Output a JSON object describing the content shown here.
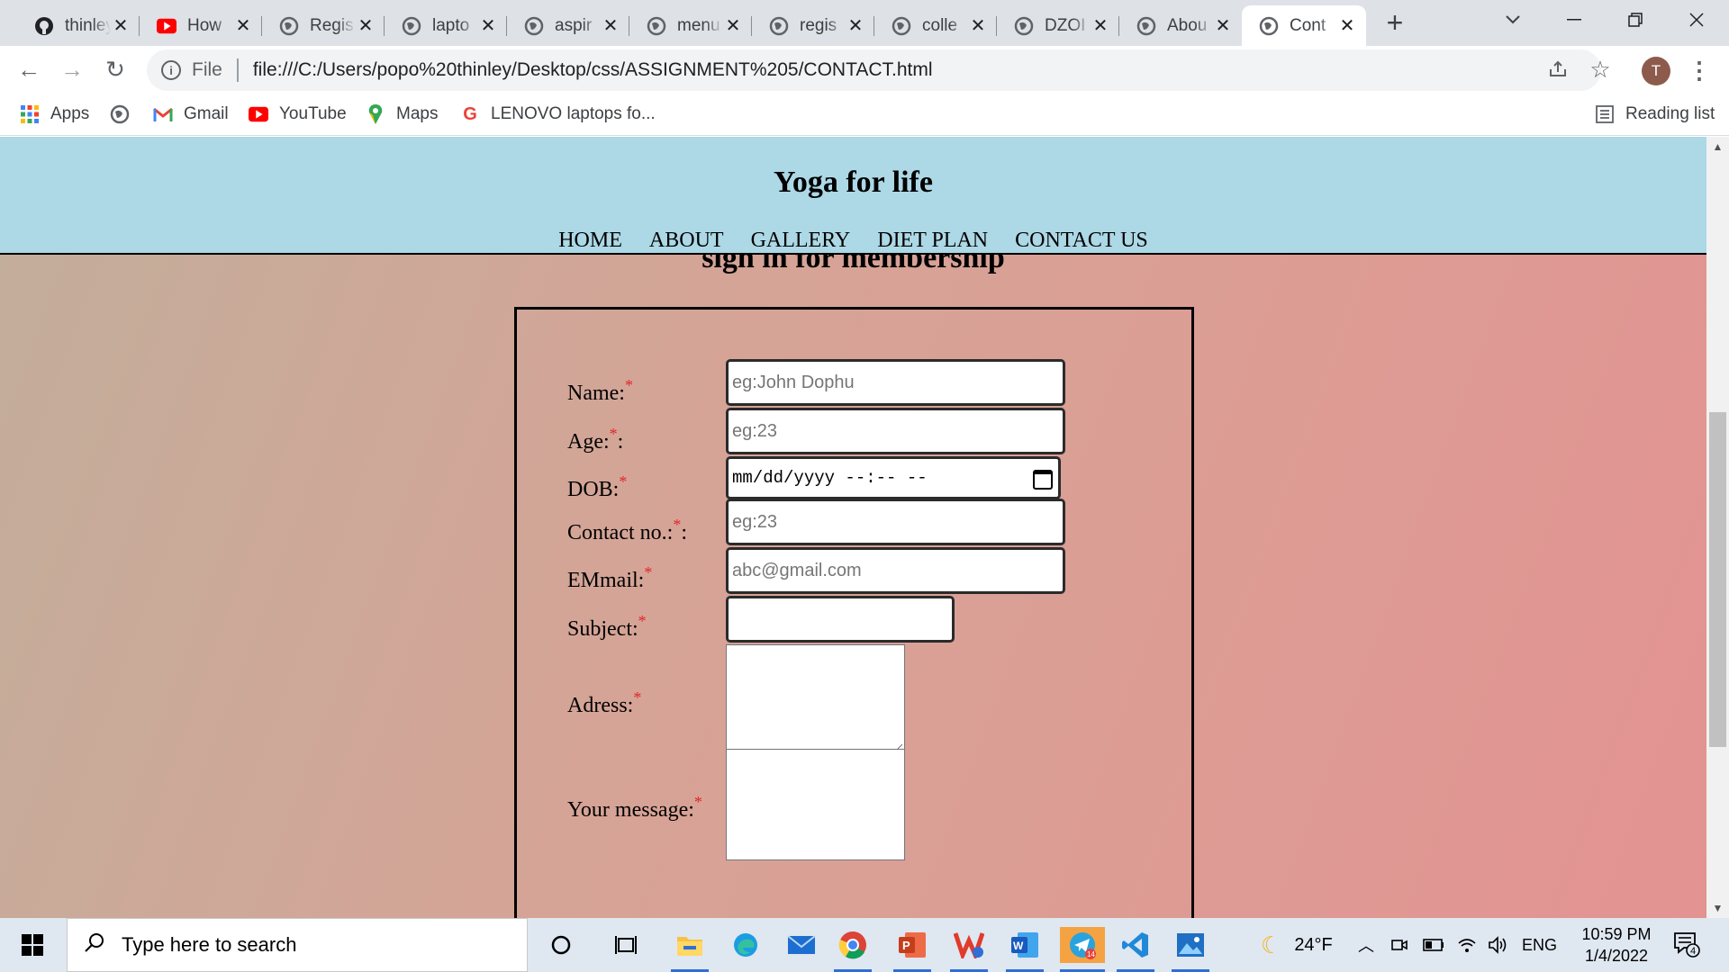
{
  "browser": {
    "tabs": [
      {
        "title": "thinley",
        "icon": "github-icon"
      },
      {
        "title": "How",
        "icon": "youtube-icon"
      },
      {
        "title": "Regis",
        "icon": "globe-icon"
      },
      {
        "title": "lapto",
        "icon": "globe-icon"
      },
      {
        "title": "aspir",
        "icon": "globe-icon"
      },
      {
        "title": "menu",
        "icon": "globe-icon"
      },
      {
        "title": "regis",
        "icon": "globe-icon"
      },
      {
        "title": "colle",
        "icon": "globe-icon"
      },
      {
        "title": "DZOI",
        "icon": "globe-icon"
      },
      {
        "title": "Abou",
        "icon": "globe-icon"
      },
      {
        "title": "Cont",
        "icon": "globe-icon",
        "active": true
      }
    ],
    "address": {
      "scheme_label": "File",
      "url": "file:///C:/Users/popo%20thinley/Desktop/css/ASSIGNMENT%205/CONTACT.html"
    },
    "profile_initial": "T",
    "bookmarks": [
      {
        "label": "Apps",
        "icon": "apps-grid-icon"
      },
      {
        "label": "",
        "icon": "globe-icon"
      },
      {
        "label": "Gmail",
        "icon": "gmail-icon"
      },
      {
        "label": "YouTube",
        "icon": "youtube-icon"
      },
      {
        "label": "Maps",
        "icon": "maps-pin-icon"
      },
      {
        "label": "LENOVO laptops fo...",
        "icon": "google-icon"
      }
    ],
    "reading_list": "Reading list"
  },
  "site": {
    "title": "Yoga for life",
    "nav": [
      "HOME",
      "ABOUT",
      "GALLERY",
      "DIET PLAN",
      "CONTACT US"
    ],
    "page_heading": "sign in for membership",
    "form": {
      "name_label": "Name:",
      "name_placeholder": "eg:John Dophu",
      "age_label": "Age:",
      "age_suffix": ":",
      "age_placeholder": "eg:23",
      "dob_label": "DOB:",
      "dob_value": "mm/dd/yyyy --:-- --",
      "contact_label": "Contact no.:",
      "contact_suffix": ":",
      "contact_placeholder": "eg:23",
      "email_label": "EMmail:",
      "email_placeholder": "abc@gmail.com",
      "subject_label": "Subject:",
      "subject_value": "",
      "address_label": "Adress:",
      "message_label": "Your message:",
      "required_mark": "*"
    }
  },
  "taskbar": {
    "search_placeholder": "Type here to search",
    "weather": "24°F",
    "language": "ENG",
    "time": "10:59 PM",
    "date": "1/4/2022",
    "notification_count": "4",
    "telegram_badge": "14"
  },
  "colors": {
    "site_header_bg": "#add8e6",
    "page_gradient_start": "#c2ae9b",
    "page_gradient_end": "#e39392",
    "required_star": "#e3262a"
  }
}
